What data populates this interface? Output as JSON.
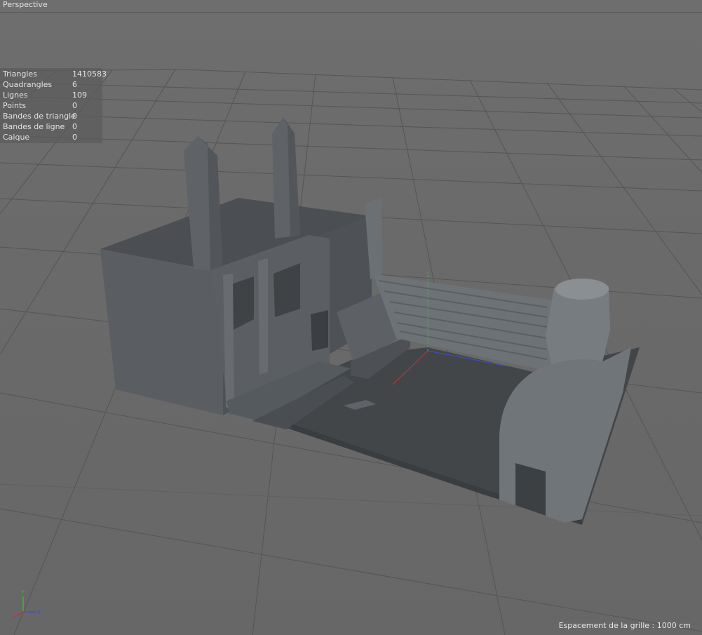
{
  "viewport": {
    "view_name": "Perspective",
    "grid_spacing": "Espacement de la grille : 1000 cm"
  },
  "stats": [
    {
      "label": "Triangles",
      "value": "1410583"
    },
    {
      "label": "Quadrangles",
      "value": "6"
    },
    {
      "label": "Lignes",
      "value": "109"
    },
    {
      "label": "Points",
      "value": "0"
    },
    {
      "label": "Bandes de triangle",
      "value": "0"
    },
    {
      "label": "Bandes de ligne",
      "value": "0"
    },
    {
      "label": "Calque",
      "value": "0"
    }
  ],
  "axes": {
    "y": "Y",
    "x": "X",
    "z": "Z"
  },
  "colors": {
    "background": "#6b6b6b",
    "grid": "#565656",
    "model": "#555a5f",
    "axis_x": "#c83232",
    "axis_y": "#3cb43c",
    "axis_z": "#3c50dc"
  }
}
